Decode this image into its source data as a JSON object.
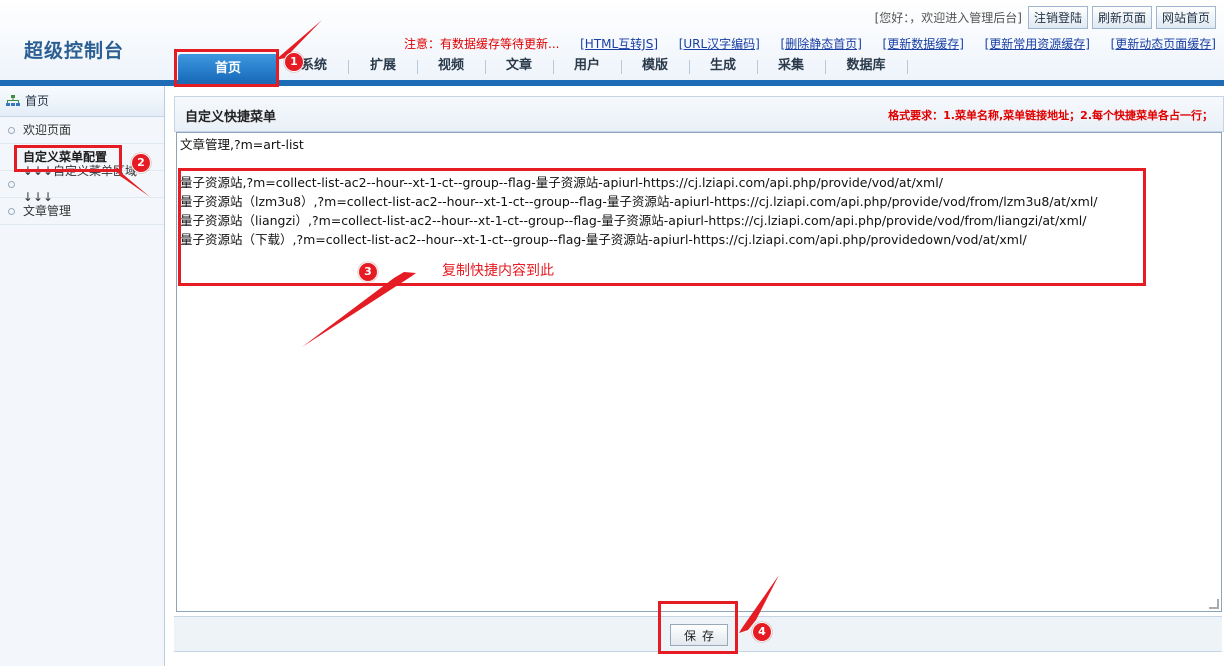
{
  "header": {
    "brand": "超级控制台",
    "welcome": "[您好：，欢迎进入管理后台]",
    "buttons": [
      "注销登陆",
      "刷新页面",
      "网站首页"
    ],
    "notice": "注意：有数据缓存等待更新...",
    "links": [
      "[HTML互转JS]",
      "[URL汉字编码]",
      "[删除静态首页]",
      "[更新数据缓存]",
      "[更新常用资源缓存]",
      "[更新动态页面缓存]"
    ]
  },
  "nav": {
    "home": "首页",
    "tabs": [
      "系统",
      "扩展",
      "视频",
      "文章",
      "用户",
      "模版",
      "生成",
      "采集",
      "数据库"
    ]
  },
  "sidebar": {
    "title": "首页",
    "items": [
      {
        "label": "欢迎页面"
      },
      {
        "label": "自定义菜单配置"
      },
      {
        "label": "↓↓↓自定义菜单区域↓↓↓"
      },
      {
        "label": "文章管理"
      }
    ]
  },
  "panel": {
    "title": "自定义快捷菜单",
    "format_note": "格式要求：1.菜单名称,菜单链接地址；2.每个快捷菜单各占一行；",
    "lines": [
      "文章管理,?m=art-list",
      "",
      "量子资源站,?m=collect-list-ac2--hour--xt-1-ct--group--flag-量子资源站-apiurl-https://cj.lziapi.com/api.php/provide/vod/at/xml/",
      "量子资源站（lzm3u8）,?m=collect-list-ac2--hour--xt-1-ct--group--flag-量子资源站-apiurl-https://cj.lziapi.com/api.php/provide/vod/from/lzm3u8/at/xml/",
      "量子资源站（liangzi）,?m=collect-list-ac2--hour--xt-1-ct--group--flag-量子资源站-apiurl-https://cj.lziapi.com/api.php/provide/vod/from/liangzi/at/xml/",
      "量子资源站（下载）,?m=collect-list-ac2--hour--xt-1-ct--group--flag-量子资源站-apiurl-https://cj.lziapi.com/api.php/providedown/vod/at/xml/"
    ],
    "save_label": "保存"
  },
  "annotations": {
    "copy_hint": "复制快捷内容到此",
    "badges": [
      "1",
      "2",
      "3",
      "4"
    ],
    "color": "#e51c23"
  },
  "colors": {
    "nav_active": "#1668b8",
    "stripe": "#1e6cb6",
    "notice": "#e00000",
    "link": "#1a3fa3"
  }
}
